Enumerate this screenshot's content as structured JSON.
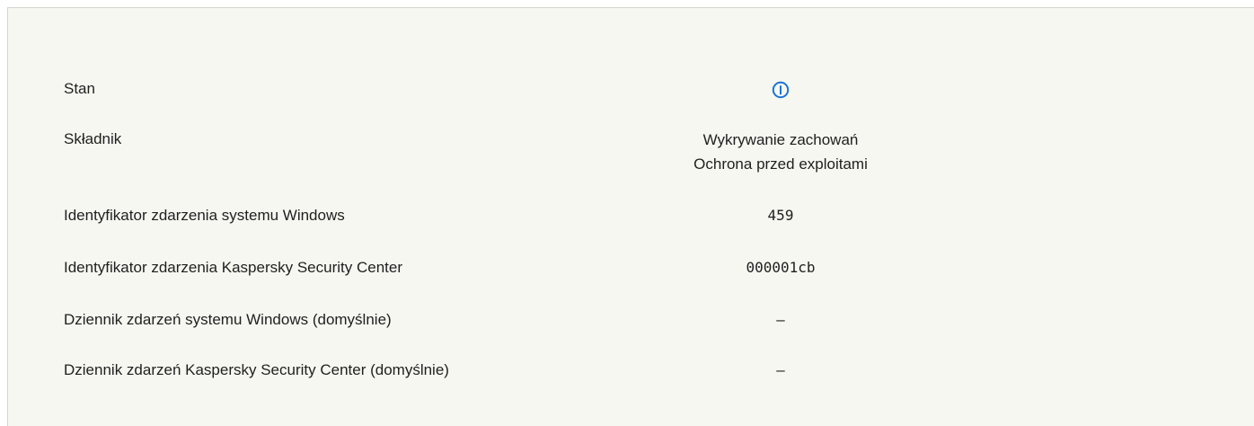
{
  "rows": [
    {
      "label": "Stan",
      "icon": "info-icon",
      "icon_color": "#1a73d9"
    },
    {
      "label": "Składnik",
      "values": [
        "Wykrywanie zachowań",
        "Ochrona przed exploitami"
      ]
    },
    {
      "label": "Identyfikator zdarzenia systemu Windows",
      "value": "459"
    },
    {
      "label": "Identyfikator zdarzenia Kaspersky Security Center",
      "value": "000001cb"
    },
    {
      "label": "Dziennik zdarzeń systemu Windows (domyślnie)",
      "value": "–"
    },
    {
      "label": "Dziennik zdarzeń Kaspersky Security Center (domyślnie)",
      "value": "–"
    }
  ]
}
